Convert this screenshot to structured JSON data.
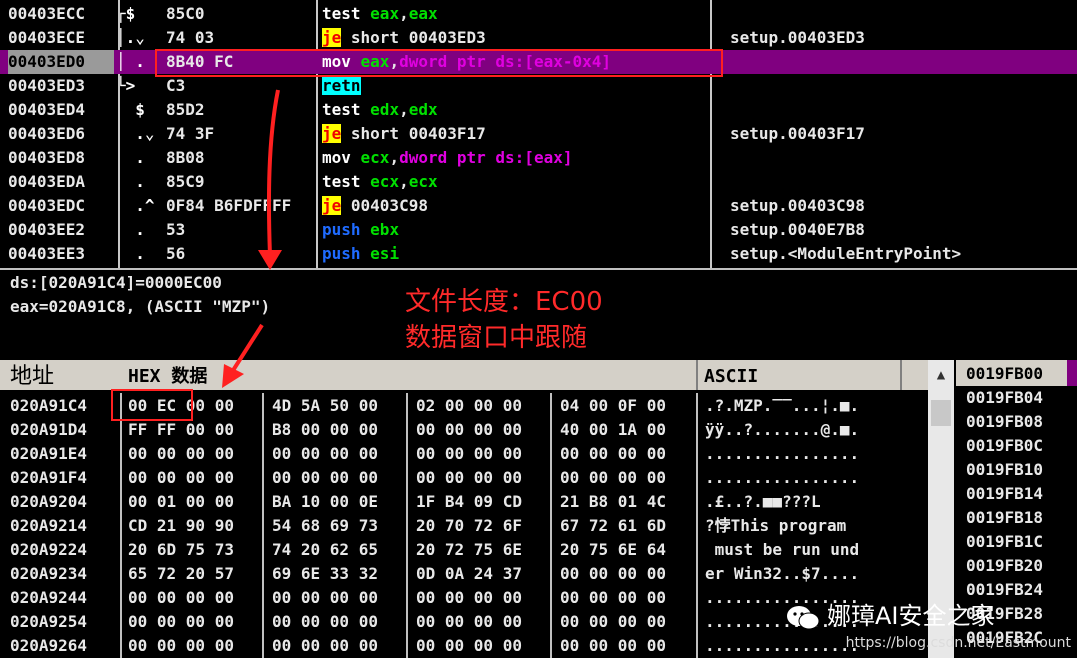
{
  "disasm": {
    "rows": [
      {
        "addr": "00403ECC",
        "arrow": "┌$",
        "hex": "85C0",
        "ins": [
          {
            "t": "test ",
            "c": "kw-test"
          },
          {
            "t": "eax",
            "c": "reg"
          },
          {
            "t": ",",
            "c": ""
          },
          {
            "t": "eax",
            "c": "reg"
          }
        ],
        "comment": ""
      },
      {
        "addr": "00403ECE",
        "arrow": "│.⌄",
        "hex": "74 03",
        "ins": [
          {
            "t": "je",
            "c": "kw-je"
          },
          {
            "t": " short 00403ED3",
            "c": ""
          }
        ],
        "comment": "setup.00403ED3"
      },
      {
        "addr": "00403ED0",
        "arrow": "│ .",
        "hex": "8B40 FC",
        "ins": [
          {
            "t": "mov ",
            "c": "kw-mov"
          },
          {
            "t": "eax",
            "c": "reg"
          },
          {
            "t": ",",
            "c": ""
          },
          {
            "t": "dword ptr ds:[eax-0x4]",
            "c": "mem"
          }
        ],
        "comment": "",
        "selected": true,
        "hl": true
      },
      {
        "addr": "00403ED3",
        "arrow": "└>",
        "hex": "C3",
        "ins": [
          {
            "t": "retn",
            "c": "kw-retn"
          }
        ],
        "comment": ""
      },
      {
        "addr": "00403ED4",
        "arrow": "  $",
        "hex": "85D2",
        "ins": [
          {
            "t": "test ",
            "c": "kw-test"
          },
          {
            "t": "edx",
            "c": "reg"
          },
          {
            "t": ",",
            "c": ""
          },
          {
            "t": "edx",
            "c": "reg"
          }
        ],
        "comment": ""
      },
      {
        "addr": "00403ED6",
        "arrow": "  .⌄",
        "hex": "74 3F",
        "ins": [
          {
            "t": "je",
            "c": "kw-je"
          },
          {
            "t": " short 00403F17",
            "c": ""
          }
        ],
        "comment": "setup.00403F17"
      },
      {
        "addr": "00403ED8",
        "arrow": "  .",
        "hex": "8B08",
        "ins": [
          {
            "t": "mov ",
            "c": "kw-mov"
          },
          {
            "t": "ecx",
            "c": "reg"
          },
          {
            "t": ",",
            "c": ""
          },
          {
            "t": "dword ptr ds:[eax]",
            "c": "mem"
          }
        ],
        "comment": ""
      },
      {
        "addr": "00403EDA",
        "arrow": "  .",
        "hex": "85C9",
        "ins": [
          {
            "t": "test ",
            "c": "kw-test"
          },
          {
            "t": "ecx",
            "c": "reg"
          },
          {
            "t": ",",
            "c": ""
          },
          {
            "t": "ecx",
            "c": "reg"
          }
        ],
        "comment": ""
      },
      {
        "addr": "00403EDC",
        "arrow": "  .^",
        "hex": "0F84 B6FDFFFF",
        "ins": [
          {
            "t": "je",
            "c": "kw-je"
          },
          {
            "t": " 00403C98",
            "c": ""
          }
        ],
        "comment": "setup.00403C98"
      },
      {
        "addr": "00403EE2",
        "arrow": "  .",
        "hex": "53",
        "ins": [
          {
            "t": "push ",
            "c": "kw-push"
          },
          {
            "t": "ebx",
            "c": "reg"
          }
        ],
        "comment": "setup.0040E7B8"
      },
      {
        "addr": "00403EE3",
        "arrow": "  .",
        "hex": "56",
        "ins": [
          {
            "t": "push ",
            "c": "kw-push"
          },
          {
            "t": "esi",
            "c": "reg"
          }
        ],
        "comment": "setup.<ModuleEntryPoint>"
      }
    ]
  },
  "info": {
    "line1": "ds:[020A91C4]=0000EC00",
    "line2": "eax=020A91C8, (ASCII \"MZP\")"
  },
  "annotation": {
    "line1": "文件长度：EC00",
    "line2": "数据窗口中跟随"
  },
  "dump": {
    "header_addr": "地址",
    "header_hex": "HEX 数据",
    "header_ascii": "ASCII",
    "rows": [
      {
        "addr": "020A91C4",
        "g": [
          "00 EC 00 00",
          "4D 5A 50 00",
          "02 00 00 00",
          "04 00 0F 00"
        ],
        "ascii": ".?.MZP.‾‾...¦.■."
      },
      {
        "addr": "020A91D4",
        "g": [
          "FF FF 00 00",
          "B8 00 00 00",
          "00 00 00 00",
          "40 00 1A 00"
        ],
        "ascii": "ÿÿ..?.......@.■."
      },
      {
        "addr": "020A91E4",
        "g": [
          "00 00 00 00",
          "00 00 00 00",
          "00 00 00 00",
          "00 00 00 00"
        ],
        "ascii": "................"
      },
      {
        "addr": "020A91F4",
        "g": [
          "00 00 00 00",
          "00 00 00 00",
          "00 00 00 00",
          "00 00 00 00"
        ],
        "ascii": "................"
      },
      {
        "addr": "020A9204",
        "g": [
          "00 01 00 00",
          "BA 10 00 0E",
          "1F B4 09 CD",
          "21 B8 01 4C"
        ],
        "ascii": ".£..?.■■???L"
      },
      {
        "addr": "020A9214",
        "g": [
          "CD 21 90 90",
          "54 68 69 73",
          "20 70 72 6F",
          "67 72 61 6D"
        ],
        "ascii": "?悖This program"
      },
      {
        "addr": "020A9224",
        "g": [
          "20 6D 75 73",
          "74 20 62 65",
          "20 72 75 6E",
          "20 75 6E 64"
        ],
        "ascii": " must be run und"
      },
      {
        "addr": "020A9234",
        "g": [
          "65 72 20 57",
          "69 6E 33 32",
          "0D 0A 24 37",
          "00 00 00 00"
        ],
        "ascii": "er Win32..$7...."
      },
      {
        "addr": "020A9244",
        "g": [
          "00 00 00 00",
          "00 00 00 00",
          "00 00 00 00",
          "00 00 00 00"
        ],
        "ascii": "................"
      },
      {
        "addr": "020A9254",
        "g": [
          "00 00 00 00",
          "00 00 00 00",
          "00 00 00 00",
          "00 00 00 00"
        ],
        "ascii": "................"
      },
      {
        "addr": "020A9264",
        "g": [
          "00 00 00 00",
          "00 00 00 00",
          "00 00 00 00",
          "00 00 00 00"
        ],
        "ascii": "................"
      }
    ]
  },
  "stack": {
    "rows": [
      "0019FB00",
      "0019FB04",
      "0019FB08",
      "0019FB0C",
      "0019FB10",
      "0019FB14",
      "0019FB18",
      "0019FB1C",
      "0019FB20",
      "0019FB24",
      "0019FB28",
      "0019FB2C"
    ]
  },
  "watermark": {
    "label": "娜璋AI安全之家",
    "url": "https://blog.csdn.net/Eastmount"
  },
  "colors": {
    "accent": "#ff2020",
    "selection": "#800080"
  }
}
